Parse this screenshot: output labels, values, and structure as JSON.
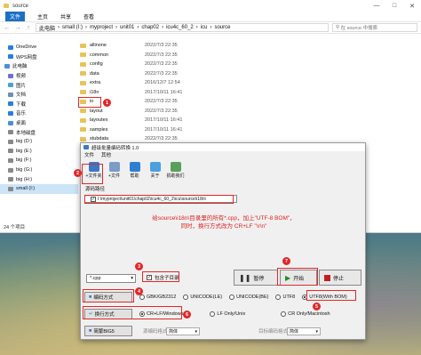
{
  "explorer": {
    "title": "source",
    "ribbon": [
      "文件",
      "主页",
      "共享",
      "查看"
    ],
    "path": [
      "此电脑",
      "small (I:)",
      "myproject",
      "unit01",
      "chap02",
      "icu4c_60_2",
      "icu",
      "source"
    ],
    "search_placeholder": "在 source 中搜索",
    "tree": [
      {
        "label": "OneDrive",
        "color": "#2a7de1"
      },
      {
        "label": "WPS网盘",
        "color": "#2a7de1"
      },
      {
        "label": "此电脑",
        "color": "#4a90d9"
      },
      {
        "label": "视频",
        "color": "#6f6fcf"
      },
      {
        "label": "图片",
        "color": "#4aa0d9"
      },
      {
        "label": "文档",
        "color": "#6f8fb0"
      },
      {
        "label": "下载",
        "color": "#2a7de1"
      },
      {
        "label": "音乐",
        "color": "#2a7de1"
      },
      {
        "label": "桌面",
        "color": "#4a90d9"
      },
      {
        "label": "本地磁盘",
        "color": "#888888"
      },
      {
        "label": "big (D:)",
        "color": "#888888"
      },
      {
        "label": "big (E:)",
        "color": "#888888"
      },
      {
        "label": "big (F:)",
        "color": "#888888"
      },
      {
        "label": "big (G:)",
        "color": "#888888"
      },
      {
        "label": "big (H:)",
        "color": "#888888"
      },
      {
        "label": "small (I:)",
        "color": "#888888"
      }
    ],
    "files": [
      {
        "name": "allinone",
        "date": "2022/7/3 22:35"
      },
      {
        "name": "common",
        "date": "2022/7/3 22:35"
      },
      {
        "name": "config",
        "date": "2022/7/3 22:35"
      },
      {
        "name": "data",
        "date": "2022/7/3 22:35"
      },
      {
        "name": "extra",
        "date": "2016/12/7 12:54"
      },
      {
        "name": "i18n",
        "date": "2017/10/11 16:41"
      },
      {
        "name": "io",
        "date": "2022/7/3 22:35"
      },
      {
        "name": "layout",
        "date": "2022/7/3 22:35"
      },
      {
        "name": "layoutex",
        "date": "2017/10/11 16:41"
      },
      {
        "name": "samples",
        "date": "2017/10/11 16:41"
      },
      {
        "name": "stubdata",
        "date": "2022/7/3 22:35"
      }
    ],
    "status": "24 个项目"
  },
  "dialog": {
    "title": "超级批量编码转换 1.0",
    "menu": [
      "文件",
      "其他"
    ],
    "tools": [
      {
        "label": "+文件夹",
        "color": "#3b78c8"
      },
      {
        "label": "+文件",
        "color": "#7a9cc6"
      },
      {
        "label": "帮助",
        "color": "#2f7fd0"
      },
      {
        "label": "关于",
        "color": "#4aa0e0"
      },
      {
        "label": "捐助我们",
        "color": "#5aa05a"
      }
    ],
    "group_label": "源码路径",
    "path_value": "I:\\myproject\\unit01\\chap02\\icu4c_60_2\\icu\\source\\i18n\\",
    "note_line1": "给source\\i18n\\目录里的所有*.cpp，加上\"UTF-8 BOM\"，",
    "note_line2": "同时，换行方式改为 CR+LF \"\\r\\n\"",
    "ext_value": "*.cpp",
    "include_subdirs": "包含子目录",
    "pause": "暂停",
    "start": "开始",
    "stop": "停止",
    "encoding_btn": "编码方式",
    "encodings": [
      {
        "label": "GBK/GB2312",
        "on": false
      },
      {
        "label": "UNICODE(LE)",
        "on": false
      },
      {
        "label": "UNICODE(BE)",
        "on": false
      },
      {
        "label": "UTF8",
        "on": false
      },
      {
        "label": "UTF8(With BOM)",
        "on": true
      }
    ],
    "newline_btn": "换行方式",
    "newlines": [
      {
        "label": "CR+LF/Windows",
        "on": true
      },
      {
        "label": "LF Only/Unix",
        "on": false
      },
      {
        "label": "CR Only/Macintosh",
        "on": false
      }
    ],
    "big5_btn": "简繁BIG5",
    "source_label": "源编码格式",
    "source_value": "简体",
    "target_label": "目标编码格式",
    "target_value": "简体"
  },
  "markers": [
    "1",
    "2",
    "3",
    "4",
    "5",
    "6",
    "7"
  ],
  "colors": {
    "accent": "#e02828",
    "ribbon_blue": "#1a6fc4"
  }
}
